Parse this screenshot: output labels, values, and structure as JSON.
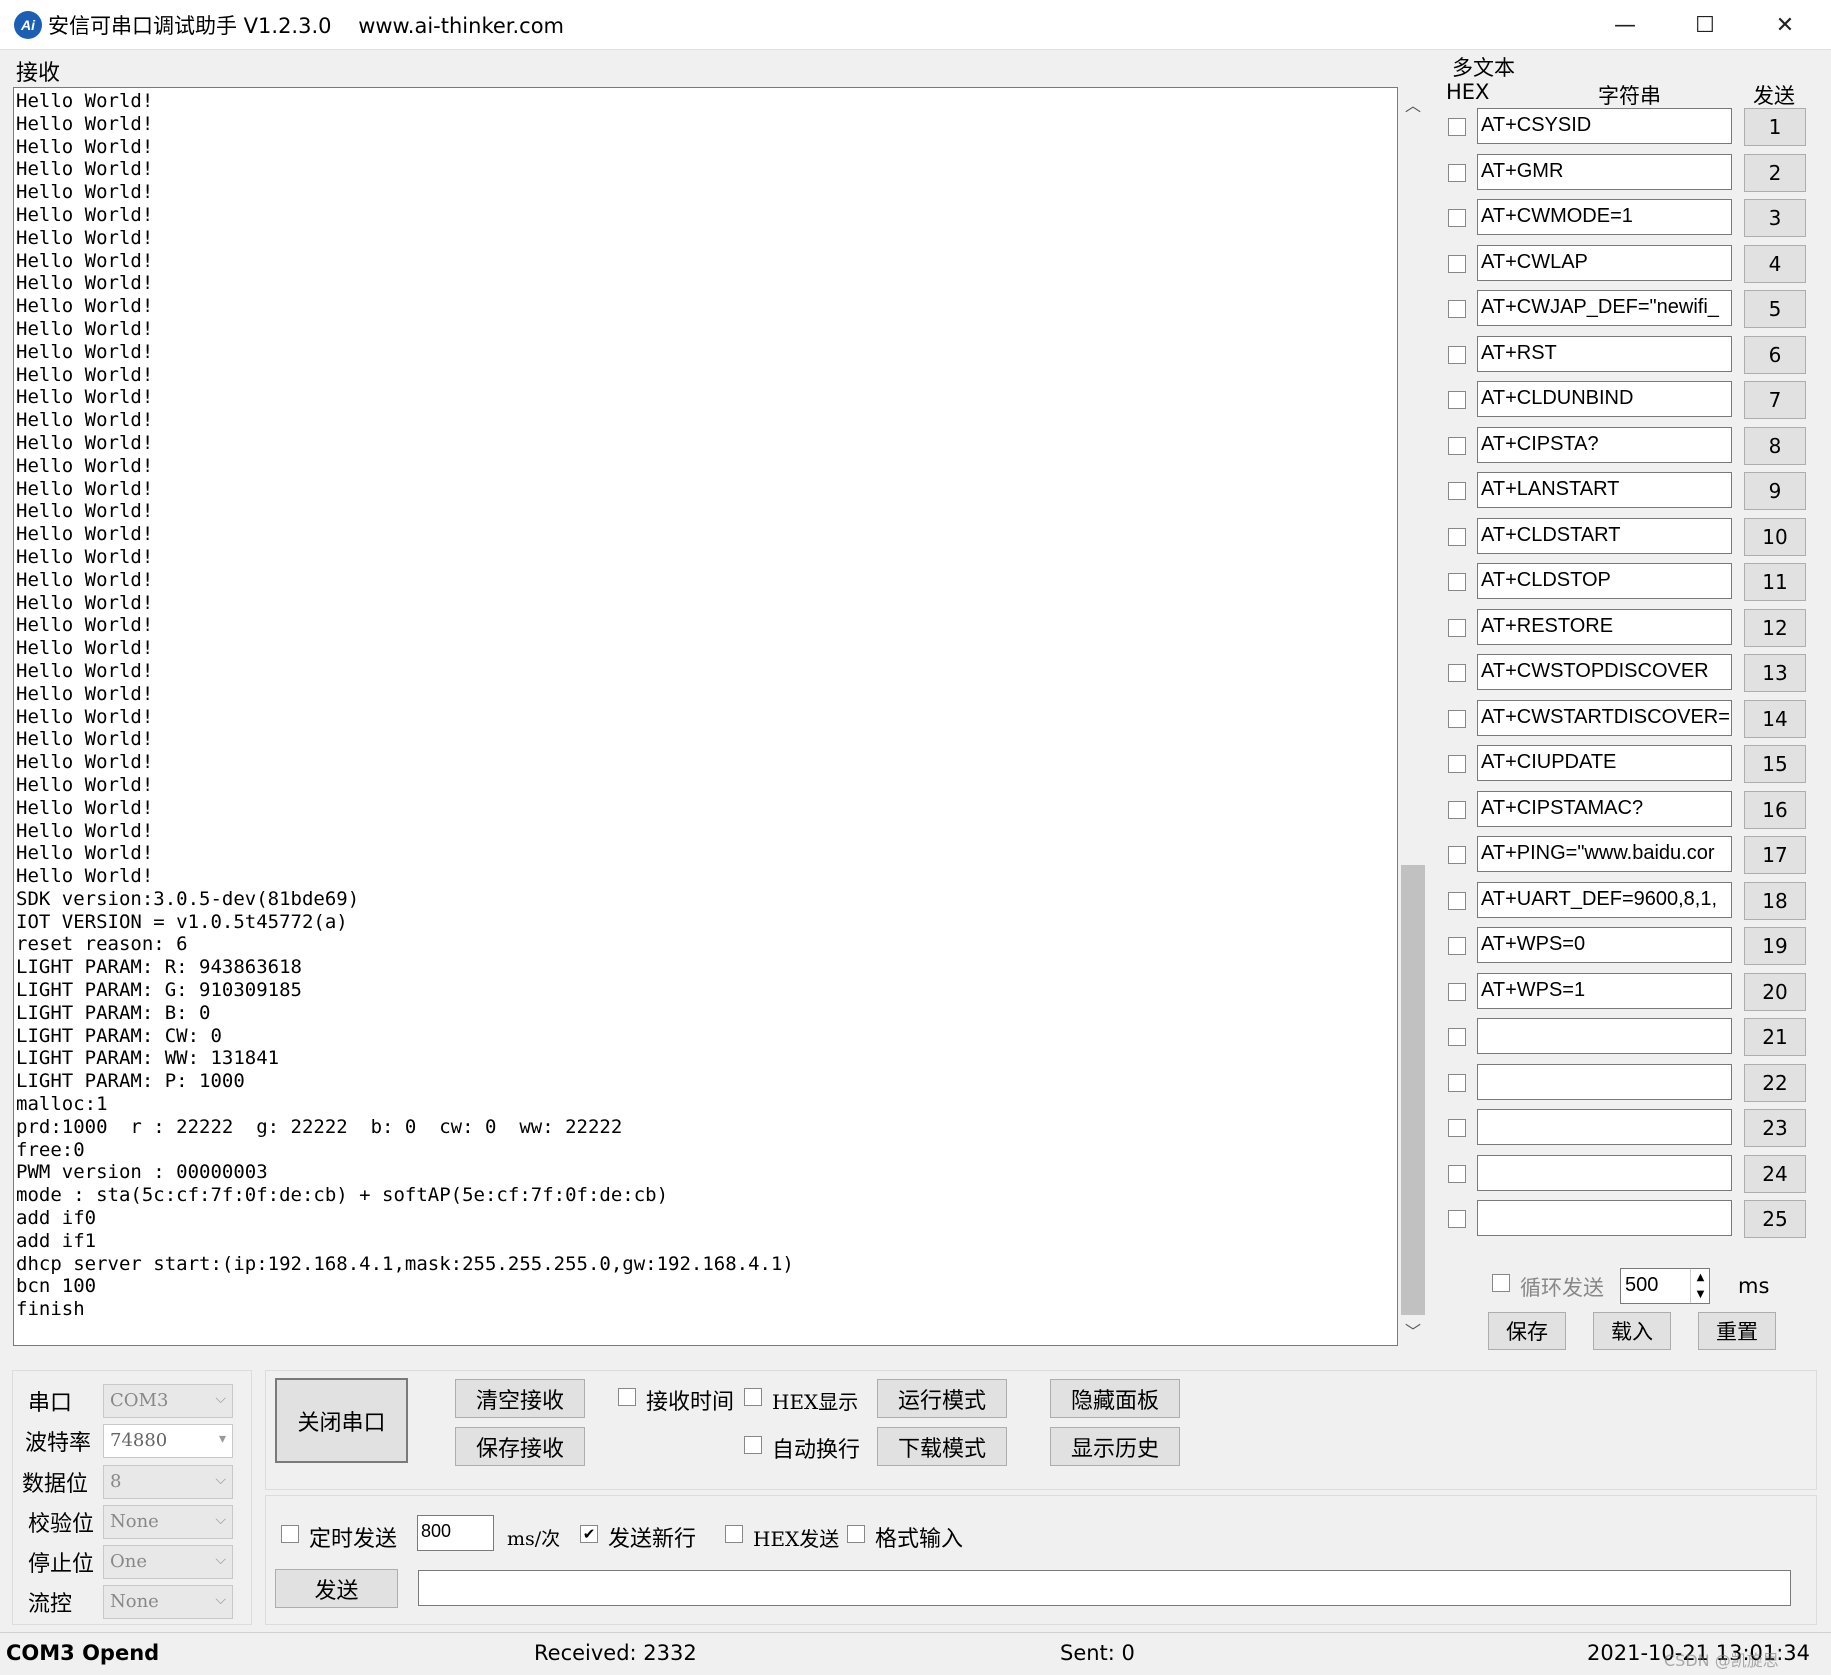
{
  "window": {
    "title": "安信可串口调试助手 V1.2.3.0    www.ai-thinker.com",
    "icon_text": "Ai",
    "minimize": "—",
    "maximize": "☐",
    "close": "✕"
  },
  "receive": {
    "label": "接收",
    "text": "Hello World!\nHello World!\nHello World!\nHello World!\nHello World!\nHello World!\nHello World!\nHello World!\nHello World!\nHello World!\nHello World!\nHello World!\nHello World!\nHello World!\nHello World!\nHello World!\nHello World!\nHello World!\nHello World!\nHello World!\nHello World!\nHello World!\nHello World!\nHello World!\nHello World!\nHello World!\nHello World!\nHello World!\nHello World!\nHello World!\nHello World!\nHello World!\nHello World!\nHello World!\nHello World!\nSDK version:3.0.5-dev(81bde69)\nIOT VERSION = v1.0.5t45772(a)\nreset reason: 6\nLIGHT PARAM: R: 943863618\nLIGHT PARAM: G: 910309185\nLIGHT PARAM: B: 0\nLIGHT PARAM: CW: 0\nLIGHT PARAM: WW: 131841\nLIGHT PARAM: P: 1000\nmalloc:1\nprd:1000  r : 22222  g: 22222  b: 0  cw: 0  ww: 22222\nfree:0\nPWM version : 00000003\nmode : sta(5c:cf:7f:0f:de:cb) + softAP(5e:cf:7f:0f:de:cb)\nadd if0\nadd if1\ndhcp server start:(ip:192.168.4.1,mask:255.255.255.0,gw:192.168.4.1)\nbcn 100\nfinish",
    "scroll_up": "︿",
    "scroll_down": "﹀"
  },
  "multi": {
    "title": "多文本",
    "col_hex": "HEX",
    "col_string": "字符串",
    "col_send": "发送",
    "rows": [
      {
        "text": "AT+CSYSID",
        "btn": "1"
      },
      {
        "text": "AT+GMR",
        "btn": "2"
      },
      {
        "text": "AT+CWMODE=1",
        "btn": "3"
      },
      {
        "text": "AT+CWLAP",
        "btn": "4"
      },
      {
        "text": "AT+CWJAP_DEF=\"newifi_",
        "btn": "5"
      },
      {
        "text": "AT+RST",
        "btn": "6"
      },
      {
        "text": "AT+CLDUNBIND",
        "btn": "7"
      },
      {
        "text": "AT+CIPSTA?",
        "btn": "8"
      },
      {
        "text": "AT+LANSTART",
        "btn": "9"
      },
      {
        "text": "AT+CLDSTART",
        "btn": "10"
      },
      {
        "text": "AT+CLDSTOP",
        "btn": "11"
      },
      {
        "text": "AT+RESTORE",
        "btn": "12"
      },
      {
        "text": "AT+CWSTOPDISCOVER",
        "btn": "13"
      },
      {
        "text": "AT+CWSTARTDISCOVER=",
        "btn": "14"
      },
      {
        "text": "AT+CIUPDATE",
        "btn": "15"
      },
      {
        "text": "AT+CIPSTAMAC?",
        "btn": "16"
      },
      {
        "text": "AT+PING=\"www.baidu.cor",
        "btn": "17"
      },
      {
        "text": "AT+UART_DEF=9600,8,1,",
        "btn": "18"
      },
      {
        "text": "AT+WPS=0",
        "btn": "19"
      },
      {
        "text": "AT+WPS=1",
        "btn": "20"
      },
      {
        "text": "",
        "btn": "21"
      },
      {
        "text": "",
        "btn": "22"
      },
      {
        "text": "",
        "btn": "23"
      },
      {
        "text": "",
        "btn": "24"
      },
      {
        "text": "",
        "btn": "25"
      }
    ],
    "loop_label": "循环发送",
    "loop_value": "500",
    "loop_unit": "ms",
    "save": "保存",
    "load": "载入",
    "reset": "重置"
  },
  "settings": {
    "port_label": "串口",
    "port_value": "COM3",
    "baud_label": "波特率",
    "baud_value": "74880",
    "data_label": "数据位",
    "data_value": "8",
    "parity_label": "校验位",
    "parity_value": "None",
    "stop_label": "停止位",
    "stop_value": "One",
    "flow_label": "流控",
    "flow_value": "None"
  },
  "controls": {
    "close_port": "关闭串口",
    "clear_recv": "清空接收",
    "save_recv": "保存接收",
    "recv_time": "接收时间",
    "hex_display": "HEX显示",
    "auto_wrap": "自动换行",
    "run_mode": "运行模式",
    "download_mode": "下载模式",
    "hide_panel": "隐藏面板",
    "show_history": "显示历史"
  },
  "send": {
    "timer_label": "定时发送",
    "timer_value": "800",
    "timer_unit": "ms/次",
    "newline_label": "发送新行",
    "newline_check": "✔",
    "hex_send": "HEX发送",
    "format_input": "格式输入",
    "send_btn": "发送",
    "send_text": ""
  },
  "status": {
    "port": "COM3 Opend",
    "received": "Received: 2332",
    "sent": "Sent: 0",
    "datetime": "2021-10-21 13:01:34",
    "watermark": "CSDN @凯旋思"
  }
}
